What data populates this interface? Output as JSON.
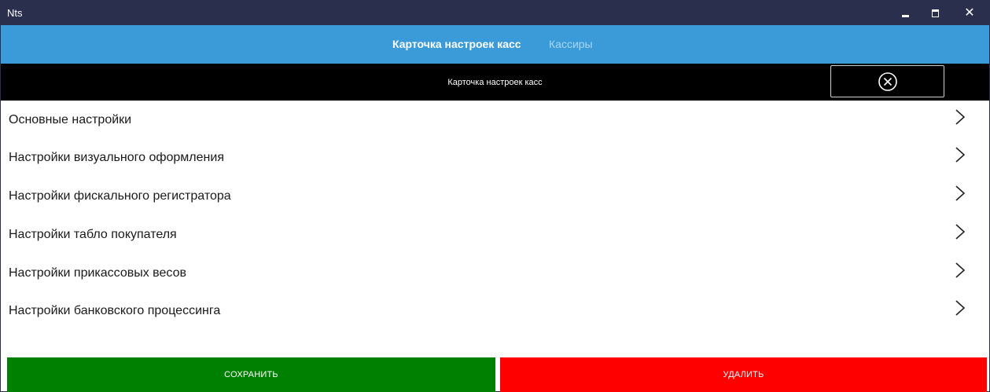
{
  "window": {
    "title": "Nts",
    "controls": {
      "minimize": "minimize-icon",
      "maximize": "maximize-icon",
      "close": "close-icon"
    }
  },
  "tabs": [
    {
      "label": "Карточка настроек касс",
      "active": true
    },
    {
      "label": "Кассиры",
      "active": false
    }
  ],
  "header": {
    "title": "Карточка настроек касс",
    "close_icon": "circle-x-icon"
  },
  "menu": {
    "items": [
      {
        "label": "Основные настройки"
      },
      {
        "label": "Настройки визуального оформления"
      },
      {
        "label": "Настройки фискального регистратора"
      },
      {
        "label": "Настройки табло покупателя"
      },
      {
        "label": "Настройки прикассовых весов"
      },
      {
        "label": "Настройки банковского процессинга"
      }
    ]
  },
  "footer": {
    "save_label": "СОХРАНИТЬ",
    "delete_label": "УДАЛИТЬ"
  },
  "colors": {
    "titlebar": "#2b2f4e",
    "tabbar": "#3b9bd9",
    "header": "#000000",
    "save": "#008000",
    "delete": "#ff0000"
  }
}
